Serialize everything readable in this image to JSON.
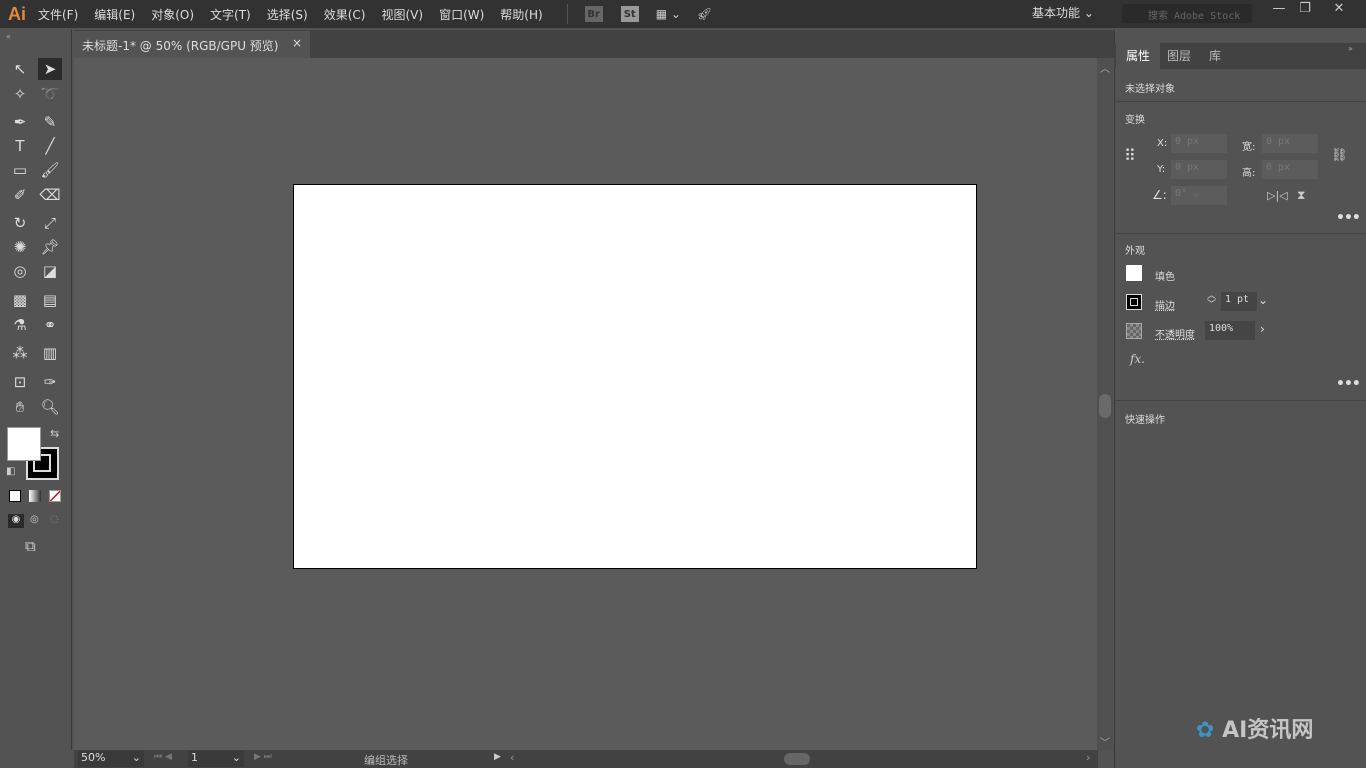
{
  "app": {
    "logo": "Ai"
  },
  "menu": [
    "文件(F)",
    "编辑(E)",
    "对象(O)",
    "文字(T)",
    "选择(S)",
    "效果(C)",
    "视图(V)",
    "窗口(W)",
    "帮助(H)"
  ],
  "toolbar_icons": {
    "bridge": "Br",
    "stock": "St"
  },
  "workspace": "基本功能",
  "search_placeholder": "搜索 Adobe Stock",
  "document_tab": {
    "title": "未标题-1* @ 50% (RGB/GPU 预览)",
    "close": "×"
  },
  "status": {
    "zoom": "50%",
    "page": "1",
    "tool": "编组选择"
  },
  "panel": {
    "tabs": [
      "属性",
      "图层",
      "库"
    ],
    "no_selection": "未选择对象",
    "transform": {
      "title": "变换",
      "x_label": "X:",
      "y_label": "Y:",
      "w_label": "宽:",
      "h_label": "高:",
      "x": "0 px",
      "y": "0 px",
      "w": "0 px",
      "h": "0 px",
      "angle": "0°"
    },
    "appearance": {
      "title": "外观",
      "fill": "填色",
      "stroke": "描边",
      "stroke_value": "1 pt",
      "opacity": "不透明度",
      "opacity_value": "100%",
      "fx": "fx."
    },
    "quick_actions": "快速操作"
  },
  "watermark": "AI资讯网",
  "colors": {
    "accent": "#e2883a",
    "fill": "#ffffff",
    "stroke": "#000000"
  }
}
